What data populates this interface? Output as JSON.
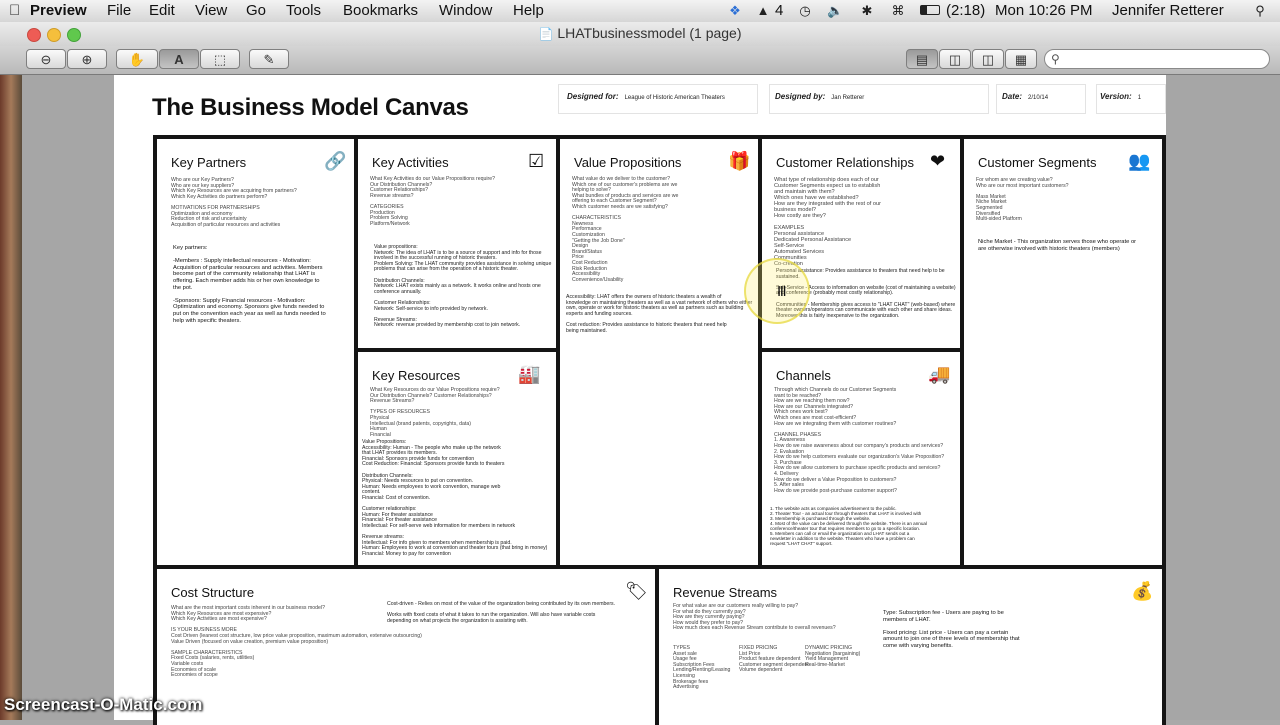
{
  "menubar": {
    "app": "Preview",
    "items": [
      "File",
      "Edit",
      "View",
      "Go",
      "Tools",
      "Bookmarks",
      "Window",
      "Help"
    ],
    "tray_count": "4",
    "battery": "(2:18)",
    "clock": "Mon 10:26 PM",
    "user": "Jennifer Retterer"
  },
  "window": {
    "title": "LHATbusinessmodel (1 page)"
  },
  "header": {
    "title": "The Business Model Canvas",
    "designed_for_label": "Designed for:",
    "designed_for_value": "League of Historic American Theaters",
    "designed_by_label": "Designed by:",
    "designed_by_value": "Jan Retterer",
    "date_label": "Date:",
    "date_value": "2/10/14",
    "version_label": "Version:",
    "version_value": "1"
  },
  "key_partners": {
    "title": "Key Partners",
    "prompts": "Who are our Key Partners?\nWho are our key suppliers?\nWhich Key Resources are we acquiring from partners?\nWhich Key Activities do partners perform?\n\nMOTIVATIONS FOR PARTNERSHIPS\nOptimization and economy\nReduction of risk and uncertainty\nAcquisition of particular resources and activities",
    "notes": "Key partners:\n\n-Members : Supply intellectual resources - Motivation:\nAcquisition of particular resources and activities.  Members\nbecome part of the community relationship that LHAT is\noffering. Each member adds his or her own knowledge to\nthe pot.\n\n-Sponsors: Supply Financial resources - Motivation:\nOptimization and economy.  Sponsors give funds needed to\nput on the convention each year as well as funds needed to\nhelp with specific theaters."
  },
  "key_activities": {
    "title": "Key Activities",
    "prompts": "What Key Activities do our Value Propositions require?\nOur Distribution Channels?\nCustomer Relationships?\nRevenue streams?\n\nCATEGORIES\nProduction\nProblem Solving\nPlatform/Network",
    "notes": "Value propositions:\nNetwork: The idea of LHAT is to be a source of support and info for those\ninvolved in the successful running of historic theaters.\nProblem Solving: The LHAT community provides assistance in solving unique\nproblems that can arise from the operation of a historic theater.\n\nDistribution Channels:\nNetwork: LHAT exists mainly as a network. It works online and hosts one\nconference annually.\n\nCustomer Relationships:\nNetwork: Self-service to info provided by network.\n\nRevenue Streams:\nNetwork: revenue provided by membership cost to join network."
  },
  "value_propositions": {
    "title": "Value Propositions",
    "prompts": "What value do we deliver to the customer?\nWhich one of our customer's problems are we\nhelping to solve?\nWhat bundles of products and services are we\noffering to each Customer Segment?\nWhich customer needs are we satisfying?\n\nCHARACTERISTICS\nNewness\nPerformance\nCustomization\n\"Getting the Job Done\"\nDesign\nBrand/Status\nPrice\nCost Reduction\nRisk Reduction\nAccessibility\nConvenience/Usability",
    "notes": "Accessibility: LHAT offers the owners of historic theaters a wealth of\nknowledge on maintaining theaters as well as a vast network of others who either\nown, operate or work for historic theaters as well as partners such as building\nexperts and funding sources.\n\nCost reduction: Provides assistance to historic theaters that need help\nbeing maintained."
  },
  "customer_relationships": {
    "title": "Customer Relationships",
    "prompts": "What type of relationship does each of our\nCustomer Segments expect us to establish\nand maintain with them?\nWhich ones have we established?\nHow are they integrated with the rest of our\nbusiness model?\nHow costly are they?\n\nEXAMPLES\nPersonal assistance\nDedicated Personal Assistance\nSelf-Service\nAutomated Services\nCommunities\nCo-creation",
    "notes": "Personal assistance: Provides assistance to theaters that need help to be\nsustained.\n\nSelf-Service - Access to information on website (cost of maintaining a website)\nand conference (probably most costly relationship).\n\nCommunities - Membership gives access to \"LHAT CHAT\" (web-based) where\ntheater owners/operators can communicate with each other and share ideas.\nMoreover this is fairly inexpensive to the organization."
  },
  "customer_segments": {
    "title": "Customer Segments",
    "prompts": "For whom are we creating value?\nWho are our most important customers?\n\nMass Market\nNiche Market\nSegmented\nDiversified\nMulti-sided Platform",
    "notes": "Niche Market - This organization serves those who operate or\nare otherwise involved with historic theaters (members)"
  },
  "key_resources": {
    "title": "Key Resources",
    "prompts": "What Key Resources do our Value Propositions require?\nOur Distribution Channels? Customer Relationships?\nRevenue Streams?\n\nTYPES OF RESOURCES\nPhysical\nIntellectual (brand patents, copyrights, data)\nHuman\nFinancial",
    "notes": "Value Propositions:\nAccessibility: Human - The people who make up the network\nthat LHAT provides its members.\n            Financial: Sponsors provide funds for convention\nCost Reduction: Financial: Sponsors provide funds to theaters\n\nDistribution Channels:\nPhysical: Needs resources to put on convention.\nHuman: Needs employees to work convention, manage web\ncontent.\nFinancial: Cost of convention.\n\nCustomer relationships:\nHuman: For theater assistance\nFinancial: For theater assistance\nIntellectual: For self-serve web information for members in network\n\nRevenue streams:\nIntellectual: For info given to members when membership is paid.\nHuman: Employees to work at convention and theater tours (that bring in money)\nFinancial: Money to pay for convention"
  },
  "channels": {
    "title": "Channels",
    "prompts": "Through which Channels do our Customer Segments\nwant to be reached?\nHow are we reaching them now?\nHow are our Channels integrated?\nWhich ones work best?\nWhich ones are most cost-efficient?\nHow are we integrating them with customer routines?\n\nCHANNEL PHASES\n1. Awareness\n   How do we raise awareness about our company's products and services?\n2. Evaluation\n   How do we help customers evaluate our organization's Value Proposition?\n3. Purchase\n   How do we allow customers to purchase specific products and services?\n4. Delivery\n   How do we deliver a Value Proposition to customers?\n5. After sales\n   How do we provide post-purchase customer support?",
    "notes": "1. The website acts as companies advertisement to the public.\n2. Theater Tour - an actual tour through theaters that LHAT is involved with\n3. Membership is purchased through the website.\n4. Most of the value can be delivered through the website. There is an annual\nconference/theater tour that requires members to go to a specific location.\n5. Members can call or email the organization and LHAT sends out a\nnewsletter in addition to the website. Theaters who have a problem can\nrequest \"LHAT CHAT\" support."
  },
  "cost_structure": {
    "title": "Cost Structure",
    "prompts": "What are the most important costs inherent in our business model?\nWhich Key Resources are most expensive?\nWhich Key Activities are most expensive?\n\nIS YOUR BUSINESS MORE\nCost Driven (leanest cost structure, low price value proposition, maximum automation, extensive outsourcing)\nValue Driven (focused on value creation, premium value proposition)\n\nSAMPLE CHARACTERISTICS\nFixed Costs (salaries, rents, utilities)\nVariable costs\nEconomies of scale\nEconomies of scope",
    "notes": "Cost-driven - Relies on most of the value of the organization being contributed by its own members.\n\nWorks with fixed costs of what it takes to run the organization. Will also have variable costs\ndepending on what projects the organization is assisting with."
  },
  "revenue_streams": {
    "title": "Revenue Streams",
    "prompts": "For what value are our customers really willing to pay?\nFor what do they currently pay?\nHow are they currently paying?\nHow would they prefer to pay?\nHow much does each Revenue Stream contribute to overall revenues?",
    "types": "TYPES\nAsset sale\nUsage fee\nSubscription Fees\nLending/Renting/Leasing\nLicensing\nBrokerage fees\nAdvertising",
    "fixed": "FIXED PRICING\nList Price\nProduct feature dependent\nCustomer segment dependent\nVolume dependent",
    "dynamic": "DYNAMIC PRICING\nNegotiation (bargaining)\nYield Management\nReal-time-Market",
    "notes": "Type: Subscription fee - Users are paying to be\nmembers of LHAT.\n\nFixed pricing: List price - Users can pay a certain\namount to join one of three levels of membership that\ncome with varying benefits."
  },
  "watermark": "Screencast-O-Matic.com"
}
